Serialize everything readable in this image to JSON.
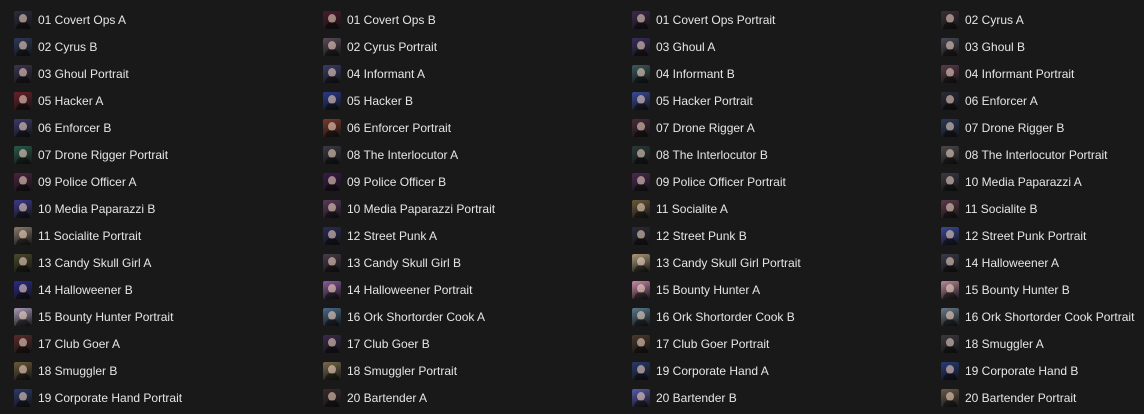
{
  "files": [
    {
      "name": "01 Covert Ops A",
      "thumb": "#2f2b3c"
    },
    {
      "name": "01 Covert Ops B",
      "thumb": "#4a1c2e"
    },
    {
      "name": "01 Covert Ops Portrait",
      "thumb": "#3b2a4a"
    },
    {
      "name": "02 Cyrus A",
      "thumb": "#3a2f38"
    },
    {
      "name": "02 Cyrus B",
      "thumb": "#2d3a5a"
    },
    {
      "name": "02 Cyrus Portrait",
      "thumb": "#5a4a58"
    },
    {
      "name": "03 Ghoul A",
      "thumb": "#3a2e5c"
    },
    {
      "name": "03 Ghoul B",
      "thumb": "#4a4a58"
    },
    {
      "name": "03 Ghoul Portrait",
      "thumb": "#3c3450"
    },
    {
      "name": "04 Informant A",
      "thumb": "#3a3c6a"
    },
    {
      "name": "04 Informant B",
      "thumb": "#3c5a5c"
    },
    {
      "name": "04 Informant Portrait",
      "thumb": "#5a3a4a"
    },
    {
      "name": "05 Hacker A",
      "thumb": "#6a2028"
    },
    {
      "name": "05 Hacker B",
      "thumb": "#2a3a8a"
    },
    {
      "name": "05 Hacker Portrait",
      "thumb": "#3a4a9a"
    },
    {
      "name": "06 Enforcer A",
      "thumb": "#2a2a3a"
    },
    {
      "name": "06 Enforcer B",
      "thumb": "#3a3a6a"
    },
    {
      "name": "06 Enforcer Portrait",
      "thumb": "#7a3a2a"
    },
    {
      "name": "07 Drone Rigger A",
      "thumb": "#4a2a3a"
    },
    {
      "name": "07 Drone Rigger B",
      "thumb": "#2a3a5a"
    },
    {
      "name": "07 Drone Rigger Portrait",
      "thumb": "#2a5a4a"
    },
    {
      "name": "08 The Interlocutor A",
      "thumb": "#3a3a42"
    },
    {
      "name": "08 The Interlocutor B",
      "thumb": "#2a3a3a"
    },
    {
      "name": "08 The Interlocutor Portrait",
      "thumb": "#4a4a4a"
    },
    {
      "name": "09 Police Officer A",
      "thumb": "#4a2240"
    },
    {
      "name": "09 Police Officer B",
      "thumb": "#3a1a48"
    },
    {
      "name": "09 Police Officer Portrait",
      "thumb": "#4a2a52"
    },
    {
      "name": "10 Media Paparazzi A",
      "thumb": "#3a3a44"
    },
    {
      "name": "10 Media Paparazzi B",
      "thumb": "#3a3a8a"
    },
    {
      "name": "10 Media Paparazzi Portrait",
      "thumb": "#5a3a5a"
    },
    {
      "name": "11 Socialite A",
      "thumb": "#6a5a3a"
    },
    {
      "name": "11 Socialite B",
      "thumb": "#5a3a4a"
    },
    {
      "name": "11 Socialite Portrait",
      "thumb": "#8a7a6a"
    },
    {
      "name": "12 Street Punk A",
      "thumb": "#2a2a5a"
    },
    {
      "name": "12 Street Punk B",
      "thumb": "#2a2a3a"
    },
    {
      "name": "12 Street Punk Portrait",
      "thumb": "#3a4a9a"
    },
    {
      "name": "13 Candy Skull Girl A",
      "thumb": "#4a4a2a"
    },
    {
      "name": "13 Candy Skull Girl B",
      "thumb": "#4a3a4a"
    },
    {
      "name": "13 Candy Skull Girl Portrait",
      "thumb": "#aa9a7a"
    },
    {
      "name": "14 Halloweener A",
      "thumb": "#3a3a4a"
    },
    {
      "name": "14 Halloweener B",
      "thumb": "#2a2a8a"
    },
    {
      "name": "14 Halloweener Portrait",
      "thumb": "#8a5a9a"
    },
    {
      "name": "15 Bounty Hunter A",
      "thumb": "#c88aa8"
    },
    {
      "name": "15 Bounty Hunter B",
      "thumb": "#b88a9a"
    },
    {
      "name": "15 Bounty Hunter Portrait",
      "thumb": "#a89ab8"
    },
    {
      "name": "16 Ork Shortorder Cook A",
      "thumb": "#4a6a8a"
    },
    {
      "name": "16 Ork Shortorder Cook B",
      "thumb": "#5a7a8a"
    },
    {
      "name": "16 Ork Shortorder Cook Portrait",
      "thumb": "#6a7a8a"
    },
    {
      "name": "17 Club Goer A",
      "thumb": "#5a2a2a"
    },
    {
      "name": "17 Club Goer B",
      "thumb": "#3a2a4a"
    },
    {
      "name": "17 Club Goer Portrait",
      "thumb": "#4a3a2a"
    },
    {
      "name": "18 Smuggler A",
      "thumb": "#3a3a42"
    },
    {
      "name": "18 Smuggler B",
      "thumb": "#6a5a3a"
    },
    {
      "name": "18 Smuggler Portrait",
      "thumb": "#7a6a4a"
    },
    {
      "name": "19 Corporate Hand A",
      "thumb": "#2a3a6a"
    },
    {
      "name": "19 Corporate Hand B",
      "thumb": "#2a3a7a"
    },
    {
      "name": "19 Corporate Hand Portrait",
      "thumb": "#2a3a6a"
    },
    {
      "name": "20 Bartender A",
      "thumb": "#3a2a2a"
    },
    {
      "name": "20 Bartender B",
      "thumb": "#5a5aaa"
    },
    {
      "name": "20 Bartender Portrait",
      "thumb": "#6a5a4a"
    }
  ]
}
